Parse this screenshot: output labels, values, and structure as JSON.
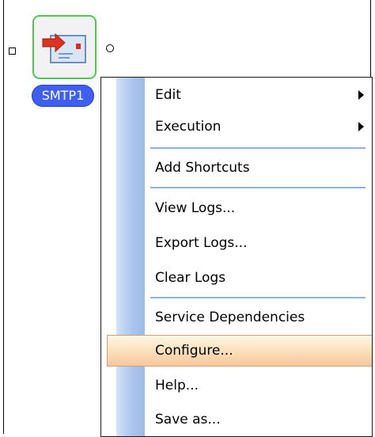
{
  "node": {
    "label": "SMTP1",
    "icon": "mail-service-icon",
    "border_color": "#4fc64f",
    "label_color": "#3f5ff4"
  },
  "context_menu": {
    "items": [
      {
        "label": "Edit",
        "submenu": true
      },
      {
        "label": "Execution",
        "submenu": true
      },
      {
        "label": "Add Shortcuts",
        "submenu": false
      },
      {
        "label": "View Logs...",
        "submenu": false
      },
      {
        "label": "Export Logs...",
        "submenu": false
      },
      {
        "label": "Clear Logs",
        "submenu": false
      },
      {
        "label": "Service Dependencies",
        "submenu": false
      },
      {
        "label": "Configure...",
        "submenu": false,
        "highlighted": true
      },
      {
        "label": "Help...",
        "submenu": false
      },
      {
        "label": "Save as...",
        "submenu": false
      }
    ],
    "hover_color": "#f8c79c",
    "separator_color": "#8fb2e6"
  }
}
